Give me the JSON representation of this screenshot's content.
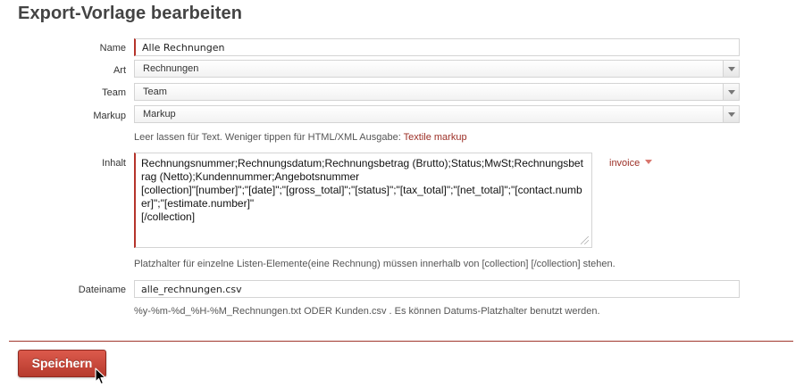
{
  "page": {
    "title": "Export-Vorlage bearbeiten"
  },
  "form": {
    "name": {
      "label": "Name",
      "value": "Alle Rechnungen"
    },
    "art": {
      "label": "Art",
      "selected": "Rechnungen"
    },
    "team": {
      "label": "Team",
      "selected": "Team"
    },
    "markup": {
      "label": "Markup",
      "selected": "Markup",
      "hint_text": "Leer lassen für Text. Weniger tippen für HTML/XML Ausgabe: ",
      "hint_link": "Textile markup"
    },
    "inhalt": {
      "label": "Inhalt",
      "value": "Rechnungsnummer;Rechnungsdatum;Rechnungsbetrag (Brutto);Status;MwSt;Rechnungsbetrag (Netto);Kundennummer;Angebotsnummer\n[collection]\"[number]\";\"[date]\";\"[gross_total]\";\"[status]\";\"[tax_total]\";\"[net_total]\";\"[contact.number]\";\"[estimate.number]\"\n[/collection]",
      "placeholder_menu": "invoice",
      "hint": "Platzhalter für einzelne Listen-Elemente(eine Rechnung) müssen innerhalb von [collection] [/collection] stehen."
    },
    "dateiname": {
      "label": "Dateiname",
      "value": "alle_rechnungen.csv",
      "hint": "%y-%m-%d_%H-%M_Rechnungen.txt ODER Kunden.csv . Es können Datums-Platzhalter benutzt werden."
    }
  },
  "actions": {
    "save_label": "Speichern"
  },
  "colors": {
    "accent": "#b5342b",
    "link": "#9c2f26",
    "button": "#c9483a"
  },
  "icons": {
    "dropdown": "chevron-down-icon",
    "pointer": "mouse-cursor-icon"
  }
}
